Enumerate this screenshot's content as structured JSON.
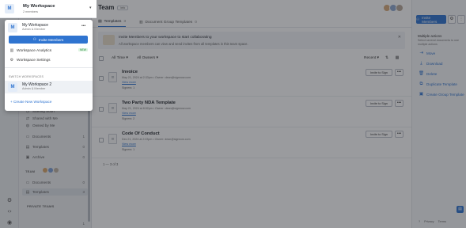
{
  "rail": {
    "icons": [
      "settings-icon",
      "code-icon",
      "user-icon"
    ]
  },
  "workspace": {
    "initial": "M",
    "name": "My Workspace",
    "members": "2 members"
  },
  "popup": {
    "current": {
      "initial": "M",
      "name": "My Workspace",
      "role": "Admin & Member",
      "more": "•••"
    },
    "invite_label": "Invite Members",
    "analytics_label": "Workspace Analytics",
    "analytics_badge": "NEW",
    "settings_label": "Workspace Settings",
    "switch_header": "SWITCH WORKSPACES",
    "other": {
      "initial": "M",
      "name": "My Workspace 2",
      "role": "Admin & Member"
    },
    "create_label": "+ Create New Workspace"
  },
  "sidebar": {
    "items_top": [
      {
        "label": "Starting Soon"
      },
      {
        "label": "Shared with Me"
      },
      {
        "label": "Owned by Me"
      }
    ],
    "items_main": [
      {
        "label": "Documents",
        "count": "1"
      },
      {
        "label": "Templates",
        "count": "0"
      },
      {
        "label": "Archive",
        "count": "0"
      }
    ],
    "team_header": "TEAM",
    "team_items": [
      {
        "label": "Documents",
        "count": "0"
      },
      {
        "label": "Templates",
        "count": "3"
      }
    ],
    "private_header": "PRIVATE TEAMS",
    "bottom_count": "1"
  },
  "header": {
    "title": "Team",
    "badge": "Info",
    "invite_label": "Invite Members"
  },
  "tabs": [
    {
      "label": "Templates",
      "count": "3"
    },
    {
      "label": "Document Group Templates",
      "count": "0"
    }
  ],
  "banner": {
    "title": "Invite Members to your workspace to start collaborating",
    "text": "All workspace members can view and send invites from all templates in this team space."
  },
  "filters": {
    "time": "All Time",
    "owners": "All Owners",
    "sort": "Recent"
  },
  "documents": [
    {
      "title": "Invoice",
      "meta": "May 21, 2024 at 2:33pm • Owner: dean@signnow.com",
      "view": "View more",
      "signers": "Signers: 1",
      "action": "Invite to Sign"
    },
    {
      "title": "Two Party NDA Template",
      "meta": "May 21, 2024 at 8:52pm • Owner: dean@signnow.com",
      "view": "View more",
      "signers": "Signers: 2",
      "action": "Invite to Sign"
    },
    {
      "title": "Code Of Conduct",
      "meta": "Dec 21, 2024 at 2:03pm • Owner: dean@signnow.com",
      "view": "View more",
      "signers": "Signers: 1",
      "action": "Invite to Sign"
    }
  ],
  "pagination": "1 — 3 of 3",
  "right_panel": {
    "title": "Multiple actions",
    "subtitle": "Select several documents to use multiple actions",
    "actions": [
      {
        "label": "Move",
        "icon": "move-icon"
      },
      {
        "label": "Download",
        "icon": "download-icon"
      },
      {
        "label": "Delete",
        "icon": "delete-icon"
      },
      {
        "label": "Duplicate Template",
        "icon": "duplicate-icon"
      },
      {
        "label": "Create Group Template",
        "icon": "group-icon"
      }
    ],
    "footer": {
      "help": "?",
      "privacy": "Privacy",
      "terms": "Terms"
    }
  }
}
